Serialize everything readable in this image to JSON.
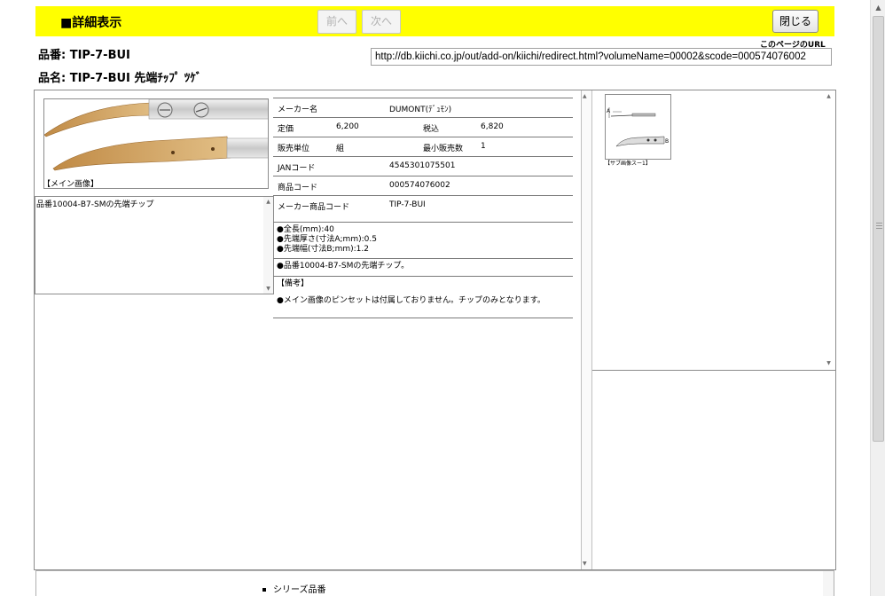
{
  "header": {
    "title": "■詳細表示",
    "prev_label": "前へ",
    "next_label": "次へ",
    "close_label": "閉じる"
  },
  "item": {
    "code_line": "品番: TIP-7-BUI",
    "name_line": "品名: TIP-7-BUI 先端ﾁｯﾌﾟ ﾂｹﾞ"
  },
  "url": {
    "label": "このページのURL",
    "value": "http://db.kiichi.co.jp/out/add-on/kiichi/redirect.html?volumeName=00002&scode=000574076002"
  },
  "main_image": {
    "caption": "【メイン画像】"
  },
  "description": "品番10004-B7-SMの先端チップ",
  "spec": {
    "maker_label": "メーカー名",
    "maker_value": "DUMONT(ﾃﾞｭﾓﾝ)",
    "price_label": "定価",
    "price_value": "6,200",
    "taxin_label": "税込",
    "taxin_value": "6,820",
    "unit_label": "販売単位",
    "unit_value": "組",
    "min_label": "最小販売数",
    "min_value": "1",
    "jan_label": "JANコード",
    "jan_value": "4545301075501",
    "product_code_label": "商品コード",
    "product_code_value": "000574076002",
    "maker_code_label": "メーカー商品コード",
    "maker_code_value": "TIP-7-BUI",
    "dims": [
      "●全長(mm):40",
      "●先端厚さ(寸法A;mm):0.5",
      "●先端幅(寸法B;mm):1.2"
    ],
    "note1": "●品番10004-B7-SMの先端チップ。",
    "remarks_label": "【備考】",
    "remarks": "●メイン画像のピンセットは付属しておりません。チップのみとなります。"
  },
  "sub_image": {
    "caption": "【サブ画像スー1】"
  },
  "bottom": {
    "series_label": "シリーズ品番"
  }
}
